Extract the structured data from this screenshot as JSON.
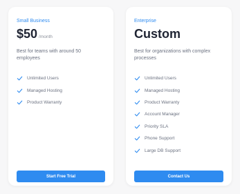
{
  "colors": {
    "accent": "#2e8bf0",
    "price_text": "#1f2433",
    "muted_text": "#6b7180",
    "background": "#f7f7f8",
    "card": "#ffffff"
  },
  "plans": [
    {
      "tier": "Small Business",
      "price": "$50",
      "period": "/month",
      "description": "Best for teams with around 50 employees",
      "features": [
        "Unlimited Users",
        "Managed Hosting",
        "Product Warranty"
      ],
      "cta_label": "Start Free Trial"
    },
    {
      "tier": "Enterprise",
      "price": "Custom",
      "period": "",
      "description": "Best for organizations with complex processes",
      "features": [
        "Unlimited Users",
        "Managed Hosting",
        "Product Warranty",
        "Account Manager",
        "Priority SLA",
        "Phone Support",
        "Large DB Support"
      ],
      "cta_label": "Contact Us"
    }
  ],
  "icons": {
    "feature_bullet": "check-icon"
  }
}
